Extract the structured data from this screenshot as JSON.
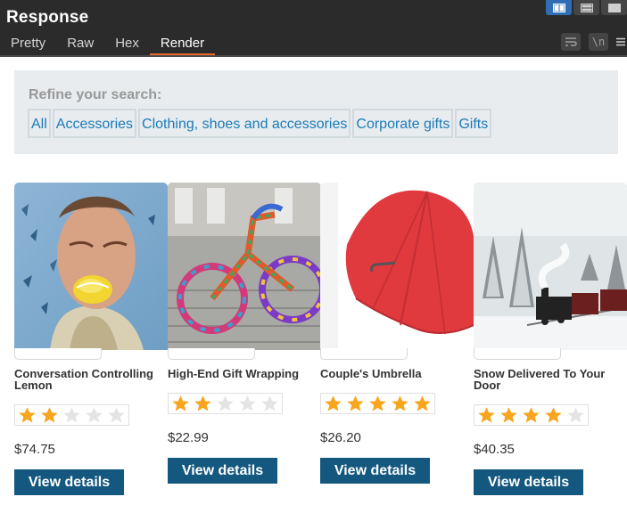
{
  "panel": {
    "title": "Response",
    "tabs": [
      {
        "label": "Pretty",
        "active": false
      },
      {
        "label": "Raw",
        "active": false
      },
      {
        "label": "Hex",
        "active": false
      },
      {
        "label": "Render",
        "active": true
      }
    ],
    "layout_buttons": [
      "split-columns-icon",
      "split-rows-icon",
      "single-pane-icon"
    ],
    "tools": {
      "wrap_icon": "word-wrap-icon",
      "newline_label": "\\n",
      "menu_icon": "menu-icon"
    }
  },
  "refine": {
    "label": "Refine your search:",
    "filters": [
      "All",
      "Accessories",
      "Clothing, shoes and accessories",
      "Corporate gifts",
      "Gifts"
    ]
  },
  "products": [
    {
      "name": "Conversation Controlling Lemon",
      "rating": 2,
      "price": "$74.75",
      "button": "View details",
      "image": "man-biting-lemon-photo"
    },
    {
      "name": "High-End Gift Wrapping",
      "rating": 2,
      "price": "$22.99",
      "button": "View details",
      "image": "yarn-bombed-bicycle-photo"
    },
    {
      "name": "Couple's Umbrella",
      "rating": 5,
      "price": "$26.20",
      "button": "View details",
      "image": "red-umbrella-photo"
    },
    {
      "name": "Snow Delivered To Your Door",
      "rating": 4,
      "price": "$40.35",
      "button": "View details",
      "image": "snowy-steam-train-photo"
    }
  ],
  "colors": {
    "panel_bg": "#2b2b2b",
    "active_tab_underline": "#e8692f",
    "filter_text": "#1a7bb8",
    "button_bg": "#14587f",
    "star_filled": "#f7a51c",
    "star_empty": "#e4e4e4"
  }
}
